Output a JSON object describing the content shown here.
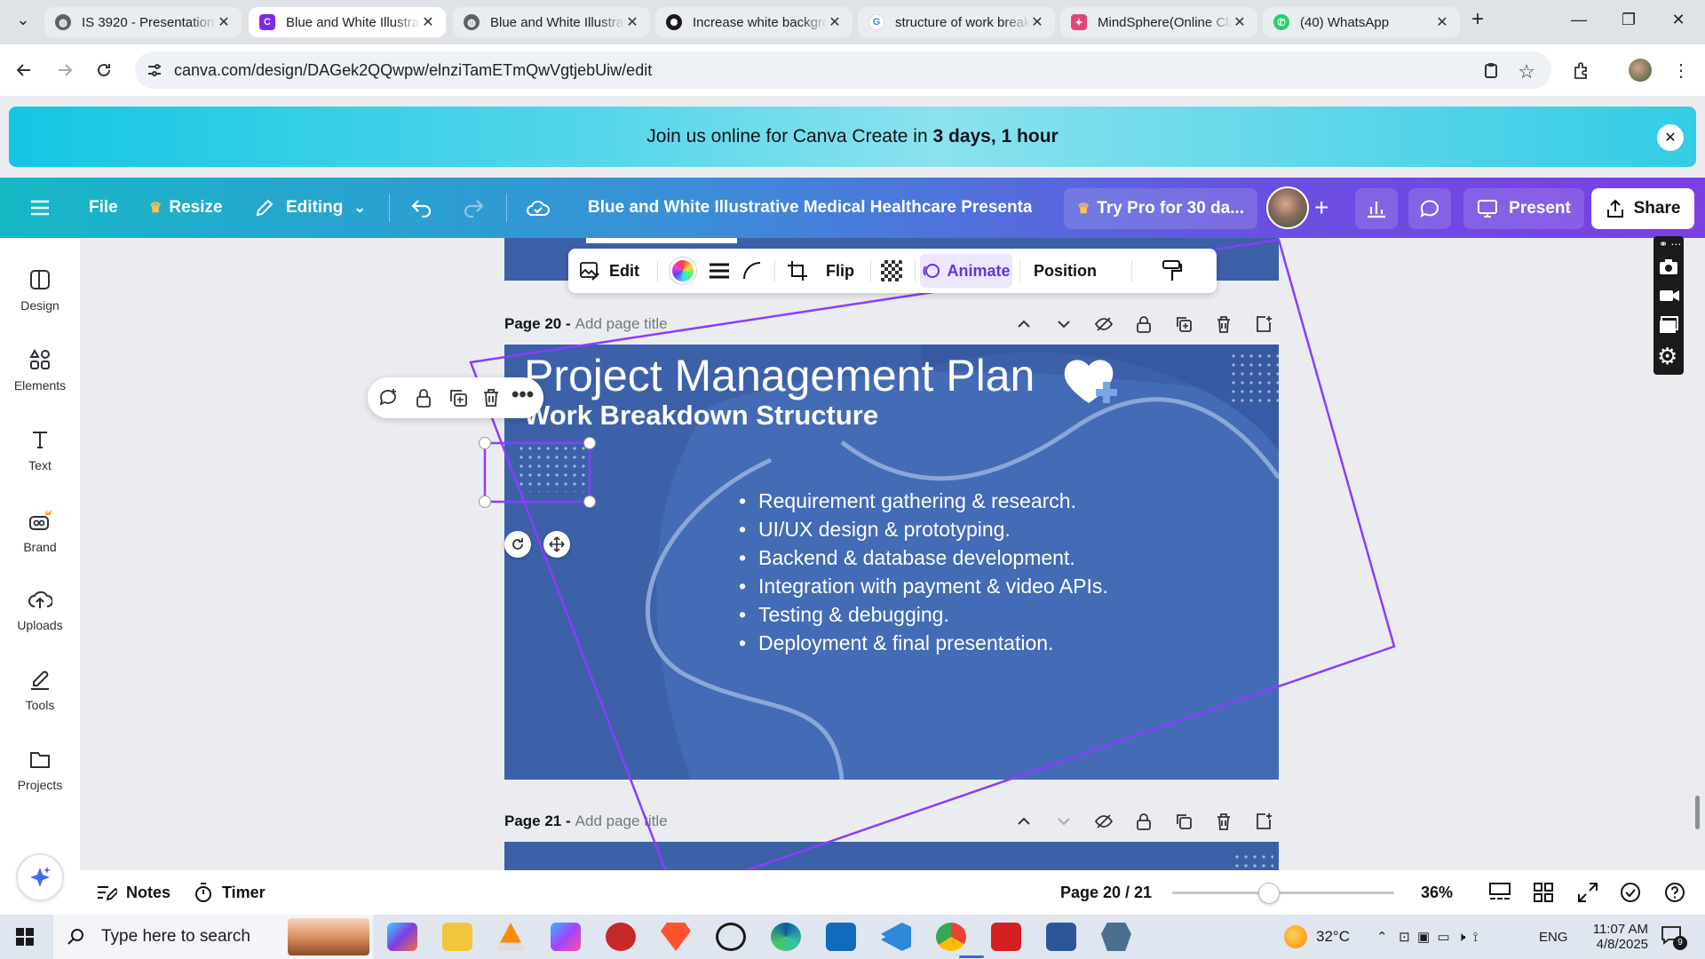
{
  "browser": {
    "tabs": [
      {
        "label": "IS 3920 - Presentation",
        "favicon": "globe-icon",
        "active": false
      },
      {
        "label": "Blue and White Illustrative",
        "favicon": "canva-icon",
        "active": true
      },
      {
        "label": "Blue and White Illustrative",
        "favicon": "globe-icon",
        "active": false
      },
      {
        "label": "Increase white background",
        "favicon": "openai-icon",
        "active": false
      },
      {
        "label": "structure of work breakdown",
        "favicon": "google-icon",
        "active": false
      },
      {
        "label": "MindSphere(Online Class)",
        "favicon": "figma-icon",
        "active": false
      },
      {
        "label": "(40) WhatsApp",
        "favicon": "whatsapp-icon",
        "active": false
      }
    ],
    "url": "canva.com/design/DAGek2QQwpw/elnziTamETmQwVgtjebUiw/edit"
  },
  "promo": {
    "text": "Join us online for Canva Create in ",
    "highlight": "3 days, 1 hour"
  },
  "toolbar": {
    "file": "File",
    "resize": "Resize",
    "editing": "Editing",
    "doc_title": "Blue and White Illustrative Medical Healthcare Presentati...",
    "try_pro": "Try Pro for 30 da...",
    "present": "Present",
    "share": "Share"
  },
  "sidebar": {
    "items": [
      {
        "label": "Design",
        "icon": "design-icon"
      },
      {
        "label": "Elements",
        "icon": "elements-icon"
      },
      {
        "label": "Text",
        "icon": "text-icon"
      },
      {
        "label": "Brand",
        "icon": "brand-icon"
      },
      {
        "label": "Uploads",
        "icon": "uploads-icon"
      },
      {
        "label": "Tools",
        "icon": "tools-icon"
      },
      {
        "label": "Projects",
        "icon": "projects-icon"
      }
    ]
  },
  "image_toolbar": {
    "edit": "Edit",
    "flip": "Flip",
    "animate": "Animate",
    "position": "Position"
  },
  "pages": {
    "current": {
      "label": "Page 20 -",
      "title_placeholder": "Add page title"
    },
    "next": {
      "label": "Page 21 -",
      "title_placeholder": "Add page title"
    }
  },
  "slide": {
    "title": "Project Management Plan",
    "subtitle": "Work Breakdown Structure",
    "bullets": [
      "Requirement gathering & research.",
      "UI/UX design & prototyping.",
      "Backend & database development.",
      "Integration with payment & video APIs.",
      "Testing & debugging.",
      "Deployment & final presentation."
    ],
    "bg_color": "#3c61a8"
  },
  "bottombar": {
    "notes": "Notes",
    "timer": "Timer",
    "page_indicator": "Page 20 / 21",
    "zoom": "36%",
    "zoom_level": 0.36
  },
  "taskbar": {
    "search_placeholder": "Type here to search",
    "weather": "32°C",
    "language": "ENG",
    "time": "11:07 AM",
    "date": "4/8/2025",
    "notification_count": "9"
  },
  "colors": {
    "accent_purple": "#8b3dff",
    "selection": "#8b3dff",
    "canva_teal": "#16b8c6"
  }
}
